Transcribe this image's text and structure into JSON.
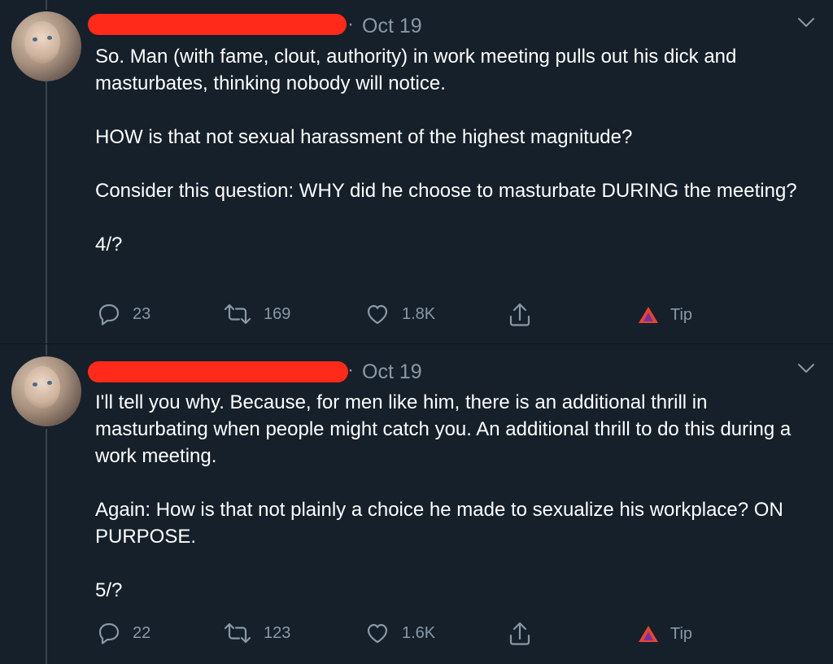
{
  "tweets": [
    {
      "date": "Oct 19",
      "paragraphs": [
        "So. Man (with fame, clout, authority) in work meeting pulls out his dick and masturbates, thinking nobody will notice.",
        "HOW is that not sexual harassment of the highest magnitude?",
        "Consider this question: WHY did he choose to masturbate DURING the meeting?",
        "4/?"
      ],
      "replies": "23",
      "retweets": "169",
      "likes": "1.8K",
      "tip_label": "Tip"
    },
    {
      "date": "Oct 19",
      "paragraphs": [
        "I'll tell you why. Because, for men like him, there is an additional thrill in masturbating when people might catch you. An additional thrill to do this during a work meeting.",
        "Again: How is that not plainly a choice he made to sexualize his workplace? ON PURPOSE.",
        "5/?"
      ],
      "replies": "22",
      "retweets": "123",
      "likes": "1.6K",
      "tip_label": "Tip"
    }
  ],
  "colors": {
    "background": "#15202b",
    "muted_text": "#8899a6",
    "thread_line": "#38444d",
    "redaction": "#ff2a1a"
  }
}
